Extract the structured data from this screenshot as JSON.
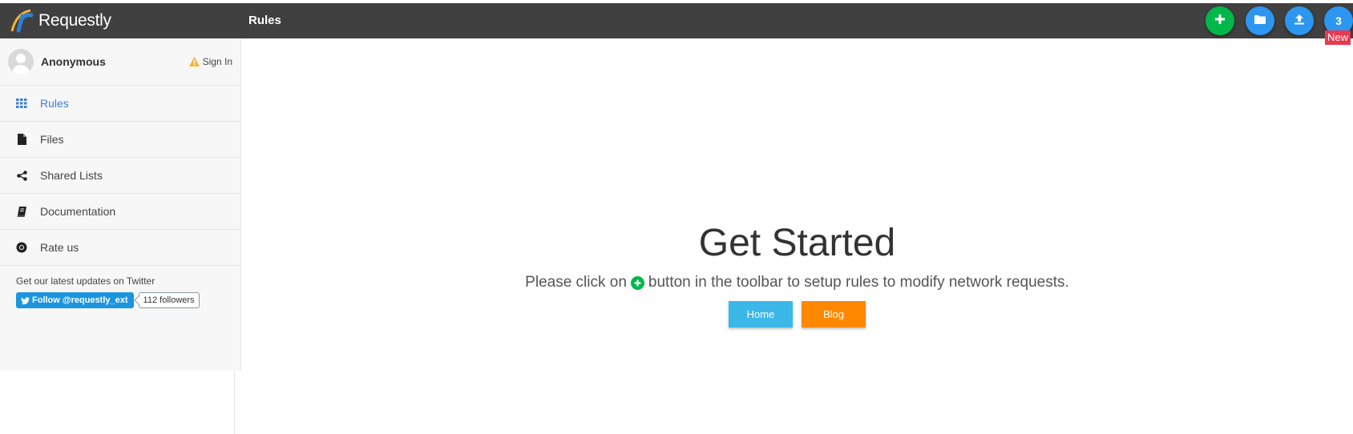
{
  "app": {
    "name": "Requestly"
  },
  "header": {
    "title": "Rules"
  },
  "toolbar": {
    "add_icon": "plus-icon",
    "folder_icon": "folder-icon",
    "upload_icon": "upload-icon",
    "notification_count": "3",
    "new_badge": "New",
    "colors": {
      "bar": "#404040",
      "green": "#00b84a",
      "blue": "#2d96f0",
      "badge": "#e8394f"
    }
  },
  "user": {
    "name": "Anonymous",
    "signin_label": "Sign In"
  },
  "sidebar": {
    "items": [
      {
        "label": "Rules",
        "icon": "grid-icon",
        "active": true
      },
      {
        "label": "Files",
        "icon": "file-icon"
      },
      {
        "label": "Shared Lists",
        "icon": "share-icon"
      },
      {
        "label": "Documentation",
        "icon": "book-icon"
      },
      {
        "label": "Rate us",
        "icon": "chrome-icon"
      }
    ],
    "twitter": {
      "text": "Get our latest updates on Twitter",
      "follow_label": "Follow @requestly_ext",
      "followers": "112 followers"
    }
  },
  "main": {
    "title": "Get Started",
    "subtitle_before": "Please click on",
    "subtitle_after": "button in the toolbar to setup rules to modify network requests.",
    "home_button": "Home",
    "blog_button": "Blog"
  }
}
